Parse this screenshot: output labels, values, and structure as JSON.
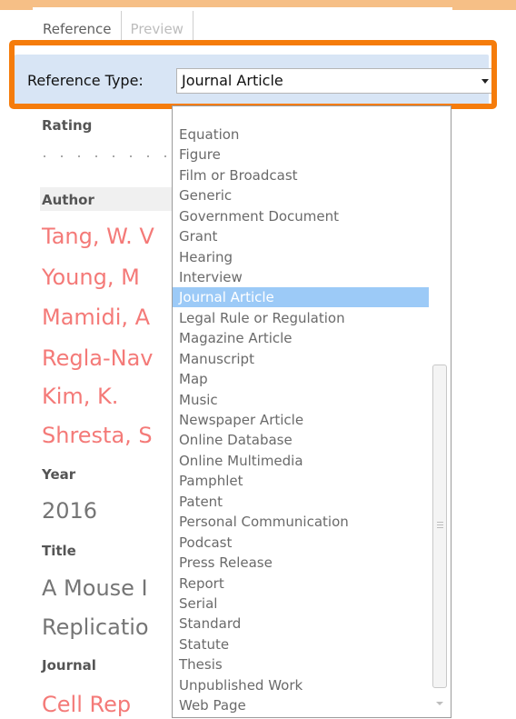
{
  "tabs": [
    {
      "label": "Reference",
      "active": true
    },
    {
      "label": "Preview",
      "active": false
    }
  ],
  "reference_type": {
    "label": "Reference Type:",
    "value": "Journal Article"
  },
  "fields": {
    "rating_label": "Rating",
    "author_label": "Author",
    "authors": [
      "Tang, W. V",
      "Young, M",
      "Mamidi, A",
      "Regla-Nav",
      "Kim, K.",
      "Shresta, S"
    ],
    "year_label": "Year",
    "year": "2016",
    "title_label": "Title",
    "title_lines": [
      "A Mouse I",
      "Replicatio"
    ],
    "journal_label": "Journal",
    "journal": "Cell Rep"
  },
  "dropdown": {
    "items": [
      "Equation",
      "Figure",
      "Film or Broadcast",
      "Generic",
      "Government Document",
      "Grant",
      "Hearing",
      "Interview",
      "Journal Article",
      "Legal Rule or Regulation",
      "Magazine Article",
      "Manuscript",
      "Map",
      "Music",
      "Newspaper Article",
      "Online Database",
      "Online Multimedia",
      "Pamphlet",
      "Patent",
      "Personal Communication",
      "Podcast",
      "Press Release",
      "Report",
      "Serial",
      "Standard",
      "Statute",
      "Thesis",
      "Unpublished Work",
      "Web Page"
    ],
    "selected": "Journal Article"
  },
  "colors": {
    "highlight_outline": "#f57c0b",
    "type_bar": "#d8e5f5",
    "selected_item": "#9ccaf7",
    "author_text": "#f47a78",
    "top_bar": "#f6bf86"
  }
}
